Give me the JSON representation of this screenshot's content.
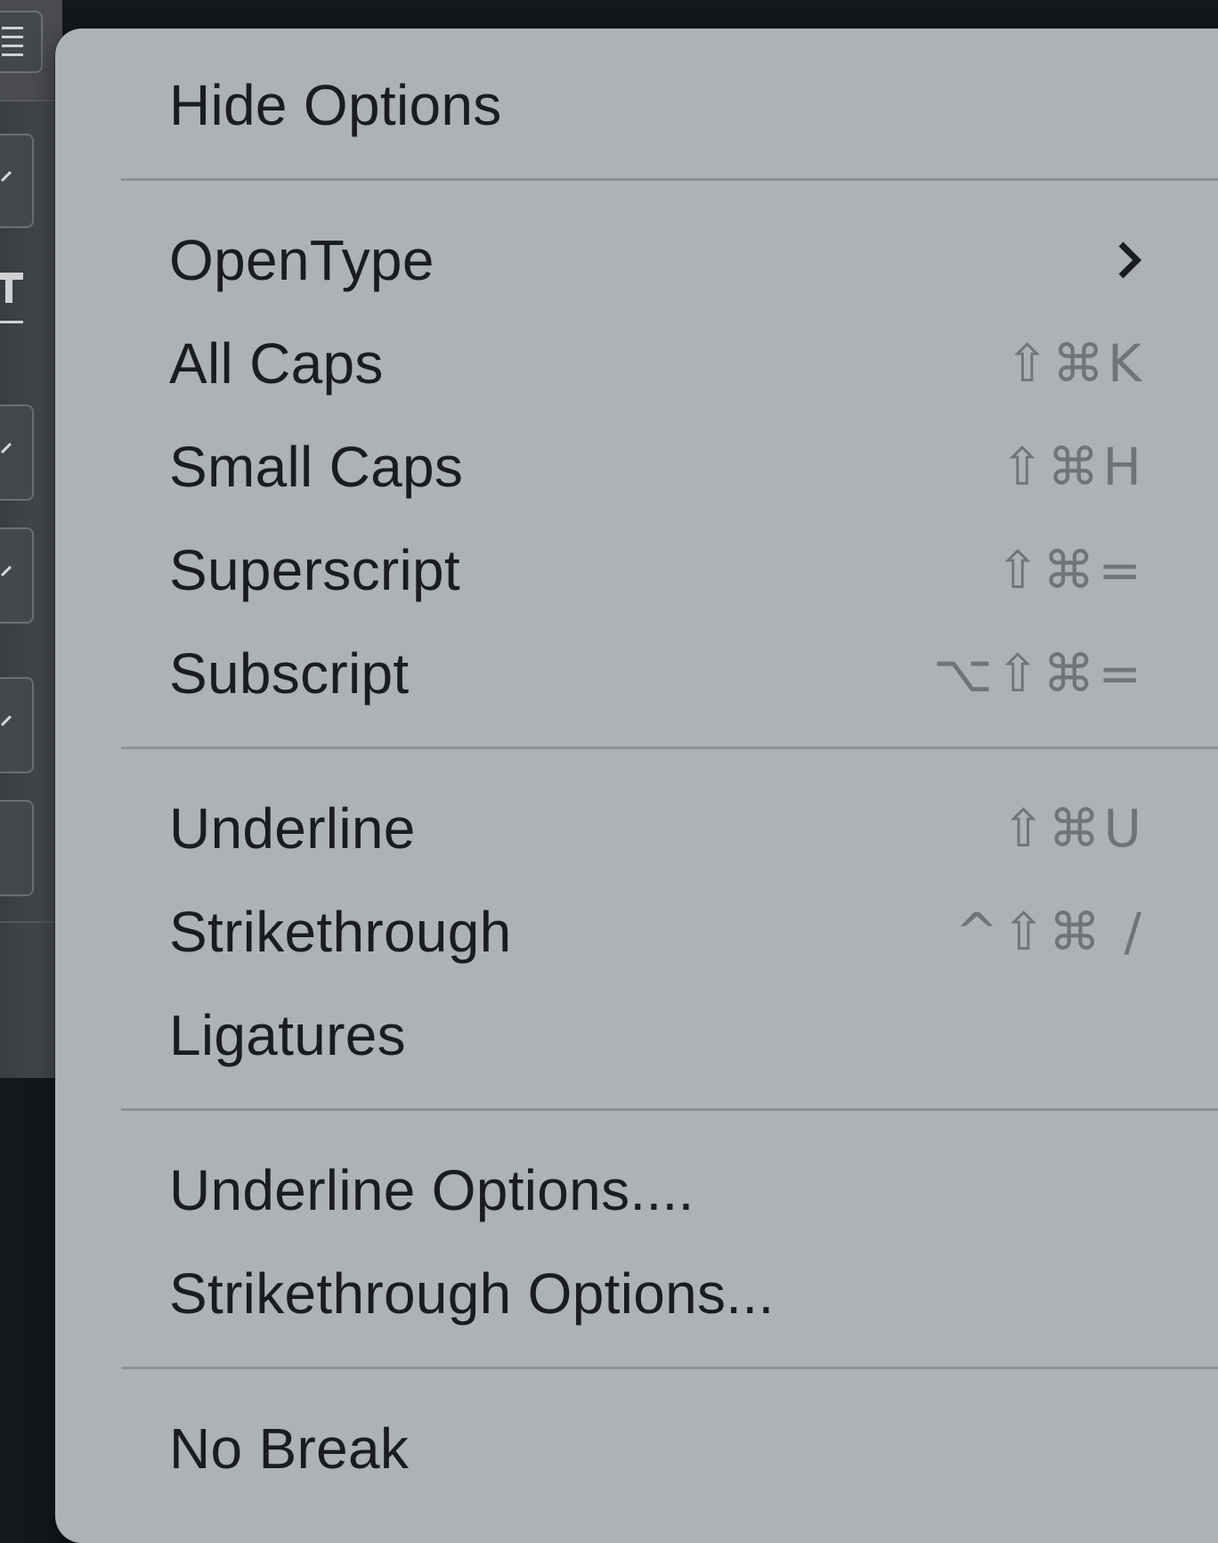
{
  "menu": {
    "sections": [
      {
        "items": [
          {
            "label": "Hide Options",
            "shortcut": ""
          }
        ]
      },
      {
        "items": [
          {
            "label": "OpenType",
            "shortcut": "",
            "submenu": true
          },
          {
            "label": "All Caps",
            "shortcut": "⇧⌘K"
          },
          {
            "label": "Small Caps",
            "shortcut": "⇧⌘H"
          },
          {
            "label": "Superscript",
            "shortcut": "⇧⌘="
          },
          {
            "label": "Subscript",
            "shortcut": "⌥⇧⌘="
          }
        ]
      },
      {
        "items": [
          {
            "label": "Underline",
            "shortcut": "⇧⌘U"
          },
          {
            "label": "Strikethrough",
            "shortcut": "^⇧⌘ /"
          },
          {
            "label": "Ligatures",
            "shortcut": ""
          }
        ]
      },
      {
        "items": [
          {
            "label": "Underline Options....",
            "shortcut": ""
          },
          {
            "label": "Strikethrough Options...",
            "shortcut": ""
          }
        ]
      },
      {
        "items": [
          {
            "label": "No Break",
            "shortcut": ""
          }
        ]
      }
    ]
  },
  "colors": {
    "menu_background": "#aeb2b6",
    "label_text": "#1b1c1e",
    "shortcut_text": "#707478",
    "separator": "#8e9296",
    "app_background": "#14181c"
  },
  "icons": {
    "side_panel": [
      "align-justify-icon",
      "checkmark-icon",
      "typography-icon",
      "checkmark-icon",
      "checkmark-icon",
      "checkmark-icon"
    ],
    "submenu": "chevron-right-icon"
  }
}
